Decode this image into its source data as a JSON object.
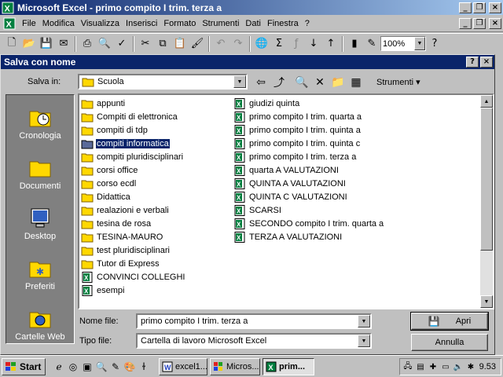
{
  "window": {
    "title": "Microsoft Excel - primo compito I trim. terza a"
  },
  "menu": [
    "File",
    "Modifica",
    "Visualizza",
    "Inserisci",
    "Formato",
    "Strumenti",
    "Dati",
    "Finestra",
    "?"
  ],
  "toolbar": {
    "zoom": "100%"
  },
  "dialog": {
    "title": "Salva con nome",
    "look_in_label": "Salva in:",
    "look_in_value": "Scuola",
    "tools_label": "Strumenti",
    "places": [
      "Cronologia",
      "Documenti",
      "Desktop",
      "Preferiti",
      "Cartelle Web"
    ],
    "folders": [
      "appunti",
      "Compiti di elettronica",
      "compiti di tdp",
      "compiti informatica",
      "compiti pluridisciplinari",
      "corsi office",
      "corso ecdl",
      "Didattica",
      "realazioni e verbali",
      "tesina de rosa",
      "TESINA-MAURO",
      "test pluridisciplinari",
      "Tutor di Express"
    ],
    "files_col1": [
      "CONVINCI COLLEGHI",
      "esempi"
    ],
    "files_col2": [
      "giudizi quinta",
      "primo compito I trim. quarta a",
      "primo compito I trim. quinta a",
      "primo compito I trim. quinta c",
      "primo compito I trim. terza a",
      "quarta A VALUTAZIONI",
      "QUINTA A VALUTAZIONI",
      "QUINTA C VALUTAZIONI",
      "SCARSI",
      "SECONDO compito I trim. quarta a",
      "TERZA A VALUTAZIONI"
    ],
    "selected_item": "compiti informatica",
    "file_name_label": "Nome file:",
    "file_name_value": "primo compito I trim. terza a",
    "file_type_label": "Tipo file:",
    "file_type_value": "Cartella di lavoro Microsoft Excel",
    "save_button": "Apri",
    "cancel_button": "Annulla"
  },
  "taskbar": {
    "start_label": "Start",
    "tasks": [
      "excel1...",
      "Micros...",
      "prim..."
    ],
    "clock": "9.53"
  },
  "colors": {
    "title_active": "#0a246a",
    "selection": "#0a246a",
    "folder": "#ffd800",
    "excel_green": "#007f3f"
  }
}
